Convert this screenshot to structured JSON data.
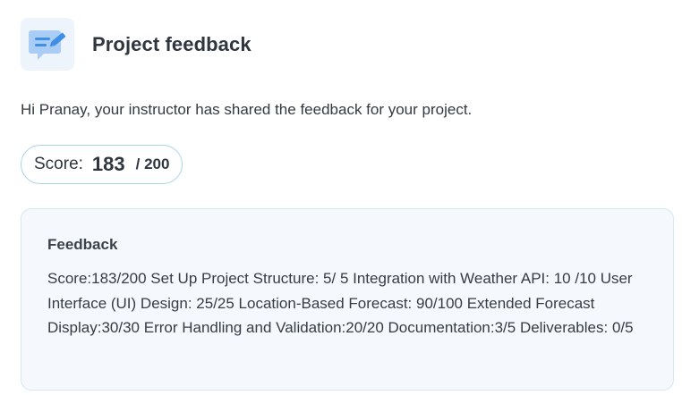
{
  "header": {
    "title": "Project feedback",
    "icon": "feedback-chat-pencil-icon"
  },
  "greeting": "Hi Pranay, your instructor has shared the feedback for your project.",
  "score": {
    "label": "Score:",
    "value": "183",
    "total": "/ 200"
  },
  "feedback": {
    "heading": "Feedback",
    "body": "Score:183/200 Set Up Project Structure: 5/ 5 Integration with Weather API: 10 /10 User Interface (UI) Design: 25/25 Location-Based Forecast: 90/100 Extended Forecast Display:30/30 Error Handling and Validation:20/20 Documentation:3/5 Deliverables: 0/5"
  },
  "colors": {
    "icon_tile": "#eef4fb",
    "icon_blue": "#3f8fe6",
    "icon_light": "#a9cdf4",
    "pill_border": "#a9d4ea",
    "card_bg": "#f5f9fd",
    "card_border": "#d3e8f3"
  }
}
